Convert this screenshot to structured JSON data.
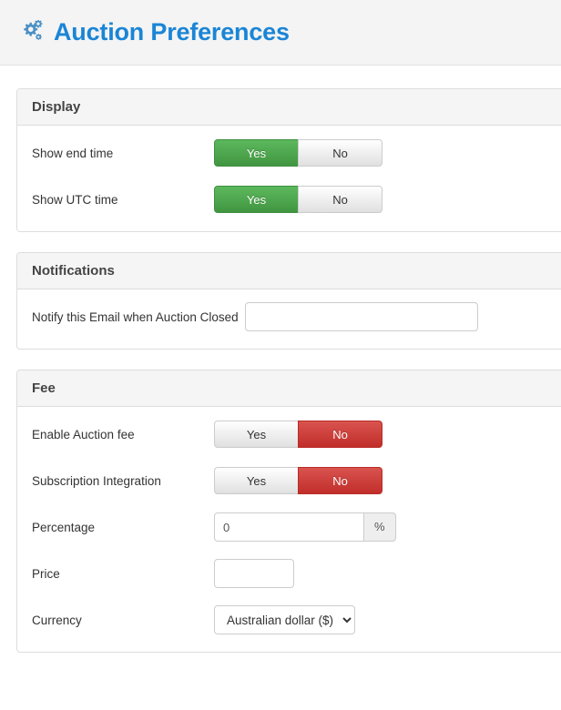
{
  "header": {
    "icon": "cogs-icon",
    "title": "Auction Preferences"
  },
  "toggle": {
    "yes_label": "Yes",
    "no_label": "No"
  },
  "colors": {
    "title_blue": "#1a85d6",
    "active_green": "#5cb85c",
    "active_red": "#d9534f",
    "panel_header_grey": "#f5f5f5",
    "page_header_grey": "#f4f4f4"
  },
  "panels": [
    {
      "title": "Display",
      "rows": [
        {
          "label": "Show end time",
          "type": "toggle",
          "value": "Yes"
        },
        {
          "label": "Show UTC time",
          "type": "toggle",
          "value": "Yes"
        }
      ]
    },
    {
      "title": "Notifications",
      "rows": [
        {
          "label": "Notify this Email when Auction Closed",
          "type": "text",
          "value": "",
          "placeholder": ""
        }
      ]
    },
    {
      "title": "Fee",
      "rows": [
        {
          "label": "Enable Auction fee",
          "type": "toggle",
          "value": "No"
        },
        {
          "label": "Subscription Integration",
          "type": "toggle",
          "value": "No"
        },
        {
          "label": "Percentage",
          "type": "number",
          "value": "0",
          "placeholder": "",
          "addon": "%"
        },
        {
          "label": "Price",
          "type": "text",
          "value": "",
          "placeholder": ""
        },
        {
          "label": "Currency",
          "type": "select",
          "value": "Australian dollar ($)",
          "options": [
            "Australian dollar ($)"
          ]
        }
      ]
    }
  ]
}
